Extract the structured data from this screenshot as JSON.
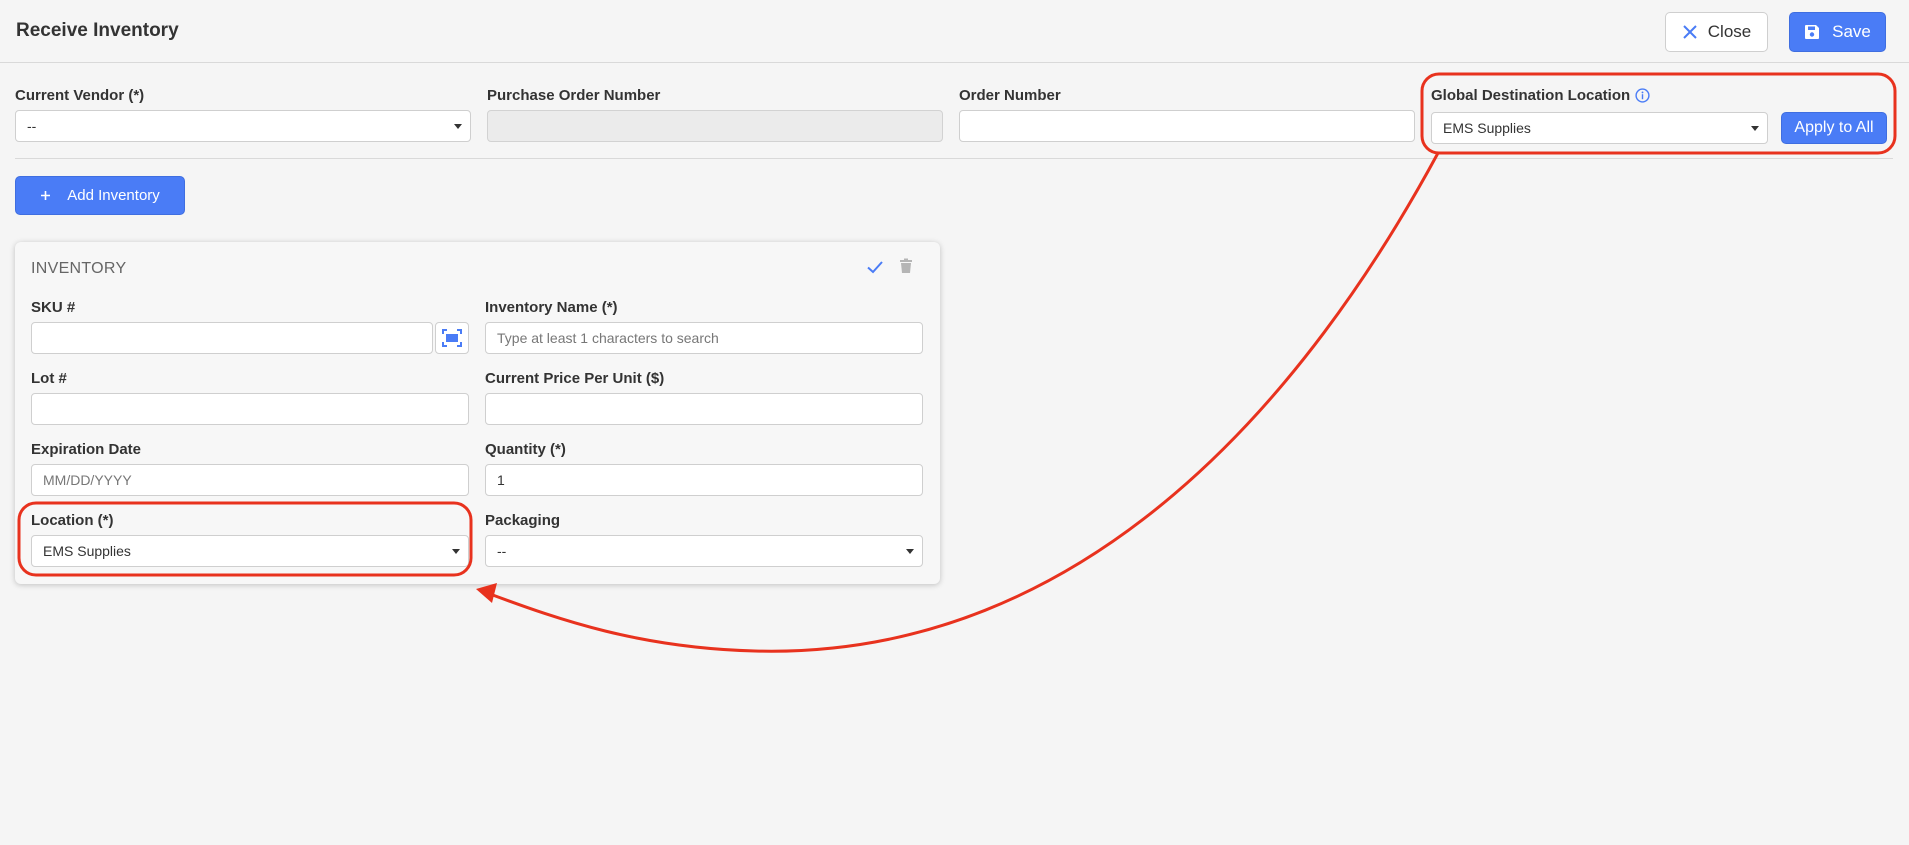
{
  "header": {
    "title": "Receive Inventory",
    "close_label": "Close",
    "save_label": "Save"
  },
  "top_form": {
    "vendor_label": "Current Vendor (*)",
    "vendor_value": "--",
    "po_label": "Purchase Order Number",
    "po_value": "",
    "order_label": "Order Number",
    "order_value": "",
    "global_location_label": "Global Destination Location",
    "global_location_value": "EMS Supplies",
    "apply_all_label": "Apply to All"
  },
  "add_inventory_label": "Add Inventory",
  "inventory_card": {
    "title": "INVENTORY",
    "sku_label": "SKU #",
    "sku_value": "",
    "name_label": "Inventory Name (*)",
    "name_placeholder": "Type at least 1 characters to search",
    "lot_label": "Lot #",
    "lot_value": "",
    "price_label": "Current Price Per Unit ($)",
    "price_value": "",
    "expiration_label": "Expiration Date",
    "expiration_placeholder": "MM/DD/YYYY",
    "quantity_label": "Quantity (*)",
    "quantity_value": "1",
    "location_label": "Location (*)",
    "location_value": "EMS Supplies",
    "packaging_label": "Packaging",
    "packaging_value": "--"
  },
  "colors": {
    "primary": "#4a7cf6",
    "annotation": "#e8321e",
    "background": "#f5f5f5"
  },
  "icons": {
    "close": "x-icon",
    "save": "floppy-disk-icon",
    "info": "info-circle-icon",
    "add": "plus-icon",
    "scan": "barcode-scan-icon",
    "confirm": "checkmark-icon",
    "delete": "trash-icon"
  }
}
